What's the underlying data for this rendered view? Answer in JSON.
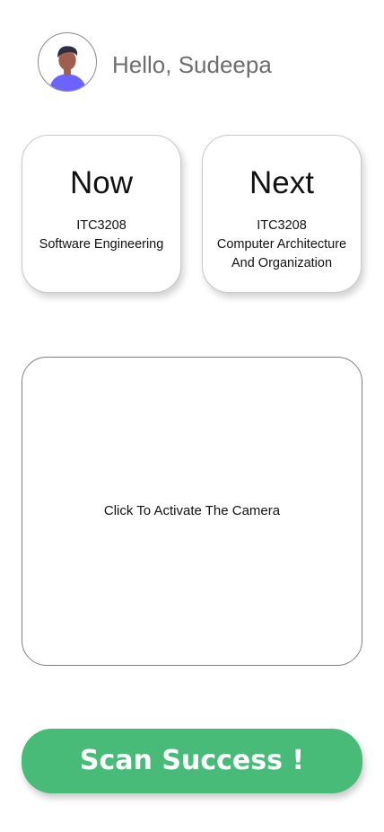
{
  "header": {
    "greeting": "Hello, Sudeepa",
    "avatar_icon": "user-avatar-icon"
  },
  "cards": {
    "now": {
      "title": "Now",
      "course_code": "ITC3208",
      "course_name_line1": "Software Engineering",
      "course_name_line2": ""
    },
    "next": {
      "title": "Next",
      "course_code": "ITC3208",
      "course_name_line1": "Computer Architecture",
      "course_name_line2": "And Organization"
    }
  },
  "camera": {
    "prompt": "Click To Activate The Camera"
  },
  "scan": {
    "label": "Scan Success !"
  },
  "colors": {
    "accent": "#48bb78",
    "avatar_shirt": "#6c63ff"
  }
}
